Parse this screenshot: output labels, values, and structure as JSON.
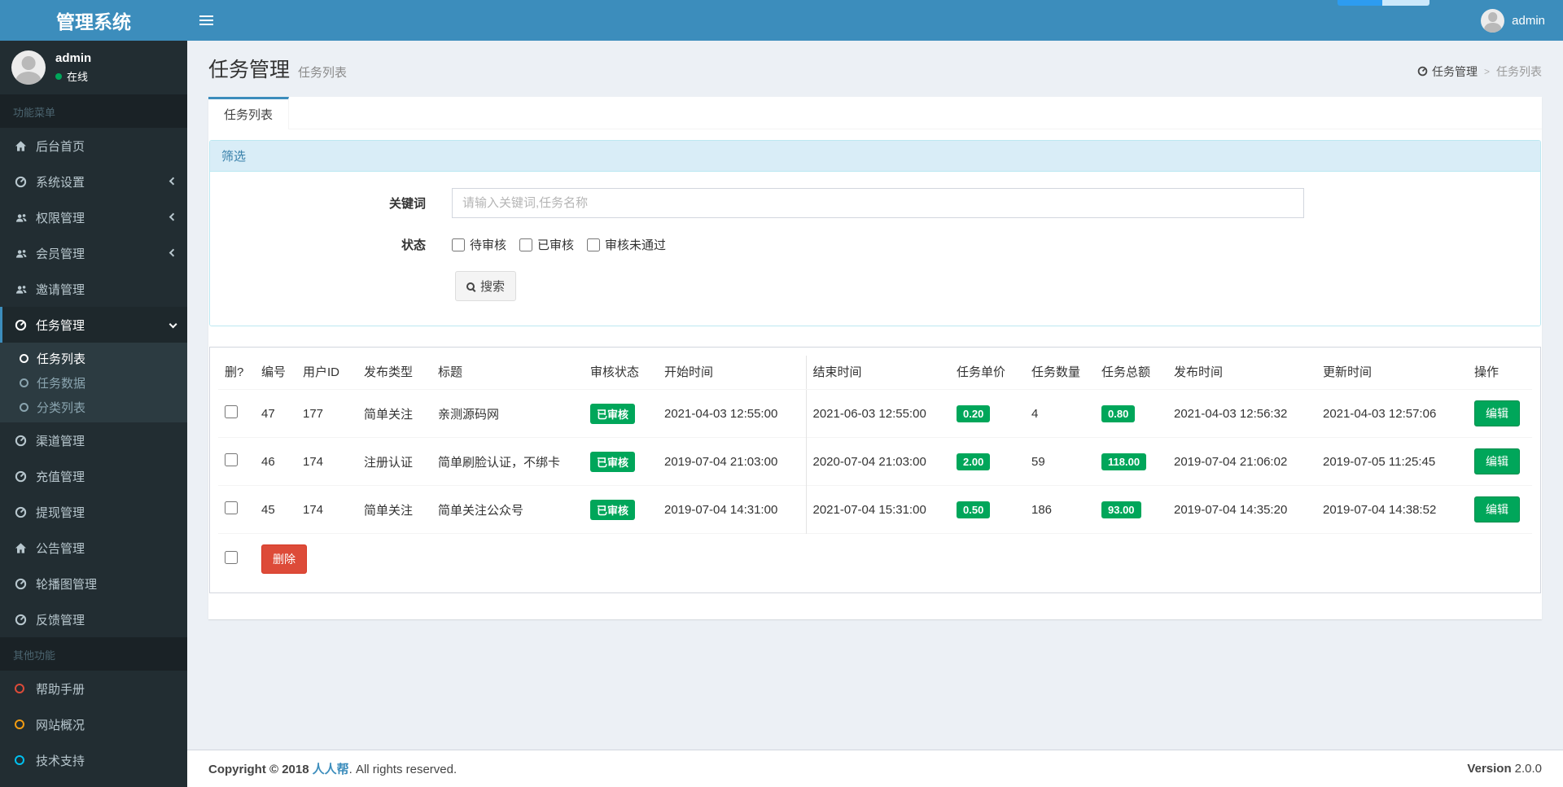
{
  "app": {
    "title": "管理系统"
  },
  "header": {
    "username": "admin"
  },
  "sidebar": {
    "user": {
      "name": "admin",
      "status": "在线"
    },
    "menu_header": "功能菜单",
    "items": [
      {
        "label": "后台首页"
      },
      {
        "label": "系统设置"
      },
      {
        "label": "权限管理"
      },
      {
        "label": "会员管理"
      },
      {
        "label": "邀请管理"
      },
      {
        "label": "任务管理"
      }
    ],
    "submenu": [
      {
        "label": "任务列表"
      },
      {
        "label": "任务数据"
      },
      {
        "label": "分类列表"
      }
    ],
    "items2": [
      {
        "label": "渠道管理"
      },
      {
        "label": "充值管理"
      },
      {
        "label": "提现管理"
      },
      {
        "label": "公告管理"
      },
      {
        "label": "轮播图管理"
      },
      {
        "label": "反馈管理"
      }
    ],
    "other_header": "其他功能",
    "items3": [
      {
        "label": "帮助手册",
        "color": "#dd4b39"
      },
      {
        "label": "网站概况",
        "color": "#f39c12"
      },
      {
        "label": "技术支持",
        "color": "#00c0ef"
      }
    ]
  },
  "content": {
    "title": "任务管理",
    "subtitle": "任务列表",
    "breadcrumb": {
      "parent": "任务管理",
      "current": "任务列表"
    },
    "tab_label": "任务列表"
  },
  "filter": {
    "title": "筛选",
    "keyword_label": "关键词",
    "keyword_placeholder": "请输入关键词,任务名称",
    "keyword_value": "",
    "status_label": "状态",
    "status_options": [
      "待审核",
      "已审核",
      "审核未通过"
    ],
    "search_label": "搜索"
  },
  "table": {
    "headers": [
      "删?",
      "编号",
      "用户ID",
      "发布类型",
      "标题",
      "审核状态",
      "开始时间",
      "结束时间",
      "任务单价",
      "任务数量",
      "任务总额",
      "发布时间",
      "更新时间",
      "操作"
    ],
    "rows": [
      {
        "id": "47",
        "user_id": "177",
        "type": "简单关注",
        "title": "亲测源码网",
        "status": "已审核",
        "start": "2021-04-03 12:55:00",
        "end": "2021-06-03 12:55:00",
        "price": "0.20",
        "count": "4",
        "total": "0.80",
        "publish": "2021-04-03 12:56:32",
        "update": "2021-04-03 12:57:06",
        "edit": "编辑"
      },
      {
        "id": "46",
        "user_id": "174",
        "type": "注册认证",
        "title": "简单刷脸认证，不绑卡",
        "status": "已审核",
        "start": "2019-07-04 21:03:00",
        "end": "2020-07-04 21:03:00",
        "price": "2.00",
        "count": "59",
        "total": "118.00",
        "publish": "2019-07-04 21:06:02",
        "update": "2019-07-05 11:25:45",
        "edit": "编辑"
      },
      {
        "id": "45",
        "user_id": "174",
        "type": "简单关注",
        "title": "简单关注公众号",
        "status": "已审核",
        "start": "2019-07-04 14:31:00",
        "end": "2021-07-04 15:31:00",
        "price": "0.50",
        "count": "186",
        "total": "93.00",
        "publish": "2019-07-04 14:35:20",
        "update": "2019-07-04 14:38:52",
        "edit": "编辑"
      }
    ],
    "delete_label": "删除"
  },
  "footer": {
    "copyright_prefix": "Copyright © 2018",
    "brand": "人人帮",
    "copyright_suffix": ". All rights reserved.",
    "version_label": "Version",
    "version": "2.0.0"
  },
  "colors": {
    "primary": "#3c8dbc",
    "success": "#00a65a",
    "danger": "#dd4b39",
    "sidebar": "#222d32"
  }
}
